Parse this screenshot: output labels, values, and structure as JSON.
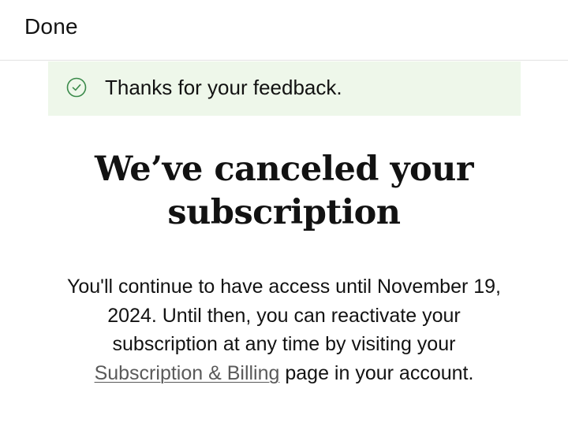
{
  "header": {
    "done_label": "Done"
  },
  "banner": {
    "icon": "check-circle-icon",
    "message": "Thanks for your feedback.",
    "background": "#eef7ea",
    "icon_color": "#3a8a4a"
  },
  "main": {
    "headline_line1": "We’ve canceled your",
    "headline_line2": "subscription",
    "body_line1": "You'll continue to have access until November 19,",
    "body_line2": "2024. Until then, you can reactivate your",
    "body_line3": "subscription at any time by visiting your",
    "link_label": "Subscription & Billing",
    "body_line4_suffix": " page in your account."
  }
}
